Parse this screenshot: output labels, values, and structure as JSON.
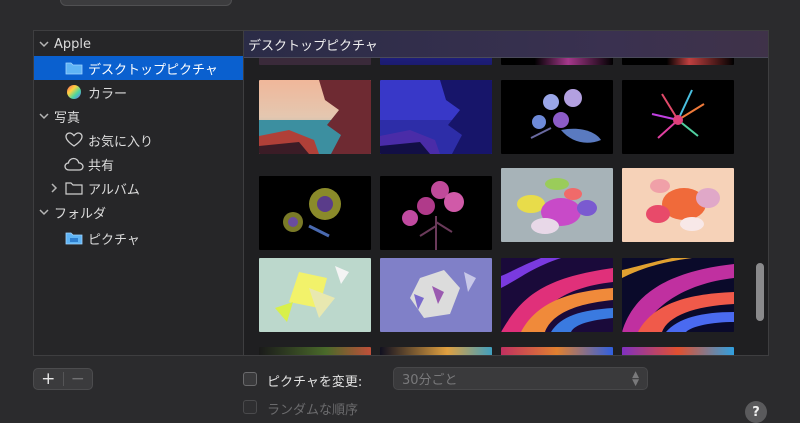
{
  "sidebar": {
    "groups": [
      {
        "label": "Apple"
      },
      {
        "label": "写真"
      },
      {
        "label": "フォルダ"
      }
    ],
    "items": [
      {
        "label": "デスクトップピクチャ",
        "icon": "folder-icon"
      },
      {
        "label": "カラー",
        "icon": "color-wheel-icon"
      },
      {
        "label": "お気に入り",
        "icon": "heart-icon"
      },
      {
        "label": "共有",
        "icon": "cloud-icon"
      },
      {
        "label": "アルバム",
        "icon": "folder-icon"
      },
      {
        "label": "ピクチャ",
        "icon": "folder-icon"
      }
    ]
  },
  "content": {
    "header": "デスクトップピクチャ"
  },
  "bottom": {
    "add_label": "+",
    "remove_label": "−",
    "change_picture_label": "ピクチャを変更:",
    "interval_value": "30分ごと",
    "random_order_label": "ランダムな順序",
    "help_label": "?"
  },
  "colors": {
    "selection": "#0a60cf",
    "header_gradient_start": "#2b2c47"
  }
}
